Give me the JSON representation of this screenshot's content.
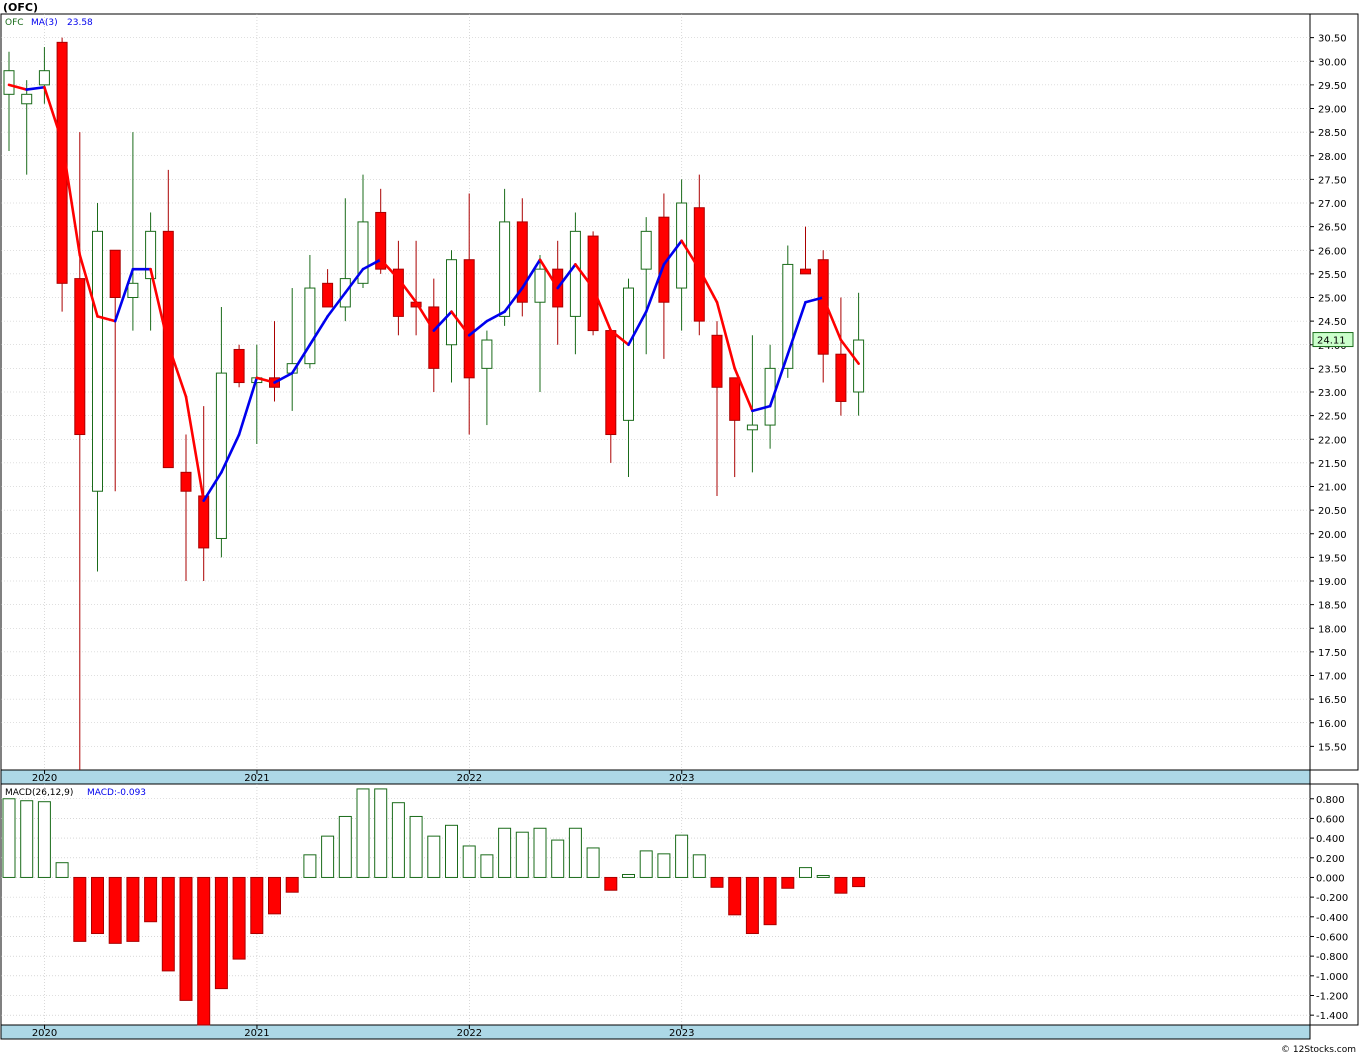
{
  "header": {
    "title": "(OFC)"
  },
  "legend": {
    "symbol": "OFC",
    "ma_label": "MA(3)",
    "ma_value": "23.58",
    "macd_label": "MACD(26,12,9)",
    "macd_value_label": "MACD:-0.093"
  },
  "last_price_label": "24.11",
  "watermark": "© 12Stocks.com",
  "colors": {
    "up": "#1a6b1a",
    "down": "#ff0000",
    "ma_up": "#0000ee",
    "ma_down": "#ff0000",
    "axis_band": "#add8e6",
    "grid": "#c0c0c0",
    "price_tag": "#ccffcc"
  },
  "chart_data": [
    {
      "type": "candlestick",
      "name": "price",
      "x_labels": [
        "2020",
        "2021",
        "2022",
        "2023"
      ],
      "x_label_index": [
        2,
        14,
        26,
        38
      ],
      "ylim": [
        15.0,
        31.0
      ],
      "yticks": [
        "15.50",
        "16.00",
        "16.50",
        "17.00",
        "17.50",
        "18.00",
        "18.50",
        "19.00",
        "19.50",
        "20.00",
        "20.50",
        "21.00",
        "21.50",
        "22.00",
        "22.50",
        "23.00",
        "23.50",
        "24.00",
        "24.50",
        "25.00",
        "25.50",
        "26.00",
        "26.50",
        "27.00",
        "27.50",
        "28.00",
        "28.50",
        "29.00",
        "29.50",
        "30.00",
        "30.50"
      ],
      "candles": [
        {
          "o": 29.3,
          "h": 30.2,
          "l": 28.1,
          "c": 29.8
        },
        {
          "o": 29.1,
          "h": 29.6,
          "l": 27.6,
          "c": 29.3
        },
        {
          "o": 29.5,
          "h": 30.3,
          "l": 29.1,
          "c": 29.8
        },
        {
          "o": 30.4,
          "h": 30.5,
          "l": 24.7,
          "c": 25.3
        },
        {
          "o": 25.4,
          "h": 28.5,
          "l": 15.0,
          "c": 22.1
        },
        {
          "o": 20.9,
          "h": 27.0,
          "l": 19.2,
          "c": 26.4
        },
        {
          "o": 26.0,
          "h": 26.0,
          "l": 20.9,
          "c": 25.0
        },
        {
          "o": 25.0,
          "h": 28.5,
          "l": 24.3,
          "c": 25.3
        },
        {
          "o": 25.4,
          "h": 26.8,
          "l": 24.3,
          "c": 26.4
        },
        {
          "o": 26.4,
          "h": 27.7,
          "l": 21.4,
          "c": 21.4
        },
        {
          "o": 21.3,
          "h": 22.1,
          "l": 19.0,
          "c": 20.9
        },
        {
          "o": 20.8,
          "h": 22.7,
          "l": 19.0,
          "c": 19.7
        },
        {
          "o": 19.9,
          "h": 24.8,
          "l": 19.5,
          "c": 23.4
        },
        {
          "o": 23.9,
          "h": 24.0,
          "l": 23.1,
          "c": 23.2
        },
        {
          "o": 23.2,
          "h": 24.0,
          "l": 21.9,
          "c": 23.3
        },
        {
          "o": 23.3,
          "h": 24.5,
          "l": 22.8,
          "c": 23.1
        },
        {
          "o": 23.4,
          "h": 25.2,
          "l": 22.6,
          "c": 23.6
        },
        {
          "o": 23.6,
          "h": 25.9,
          "l": 23.5,
          "c": 25.2
        },
        {
          "o": 25.3,
          "h": 25.6,
          "l": 24.8,
          "c": 24.8
        },
        {
          "o": 24.8,
          "h": 27.1,
          "l": 24.5,
          "c": 25.4
        },
        {
          "o": 25.3,
          "h": 27.6,
          "l": 25.2,
          "c": 26.6
        },
        {
          "o": 26.8,
          "h": 27.3,
          "l": 25.5,
          "c": 25.6
        },
        {
          "o": 25.6,
          "h": 26.2,
          "l": 24.2,
          "c": 24.6
        },
        {
          "o": 24.9,
          "h": 26.2,
          "l": 24.2,
          "c": 24.8
        },
        {
          "o": 24.8,
          "h": 25.4,
          "l": 23.0,
          "c": 23.5
        },
        {
          "o": 24.0,
          "h": 26.0,
          "l": 23.2,
          "c": 25.8
        },
        {
          "o": 25.8,
          "h": 27.2,
          "l": 22.1,
          "c": 23.3
        },
        {
          "o": 23.5,
          "h": 24.3,
          "l": 22.3,
          "c": 24.1
        },
        {
          "o": 24.6,
          "h": 27.3,
          "l": 24.4,
          "c": 26.6
        },
        {
          "o": 26.6,
          "h": 27.1,
          "l": 24.6,
          "c": 24.9
        },
        {
          "o": 24.9,
          "h": 25.9,
          "l": 23.0,
          "c": 25.6
        },
        {
          "o": 25.6,
          "h": 26.2,
          "l": 24.0,
          "c": 24.8
        },
        {
          "o": 24.6,
          "h": 26.8,
          "l": 23.8,
          "c": 26.4
        },
        {
          "o": 26.3,
          "h": 26.4,
          "l": 24.2,
          "c": 24.3
        },
        {
          "o": 24.3,
          "h": 24.3,
          "l": 21.5,
          "c": 22.1
        },
        {
          "o": 22.4,
          "h": 25.4,
          "l": 21.2,
          "c": 25.2
        },
        {
          "o": 25.6,
          "h": 26.7,
          "l": 23.8,
          "c": 26.4
        },
        {
          "o": 26.7,
          "h": 27.2,
          "l": 23.7,
          "c": 24.9
        },
        {
          "o": 25.2,
          "h": 27.5,
          "l": 24.3,
          "c": 27.0
        },
        {
          "o": 26.9,
          "h": 27.6,
          "l": 24.2,
          "c": 24.5
        },
        {
          "o": 24.2,
          "h": 24.5,
          "l": 20.8,
          "c": 23.1
        },
        {
          "o": 23.3,
          "h": 23.3,
          "l": 21.2,
          "c": 22.4
        },
        {
          "o": 22.2,
          "h": 24.2,
          "l": 21.3,
          "c": 22.3
        },
        {
          "o": 22.3,
          "h": 24.0,
          "l": 21.8,
          "c": 23.5
        },
        {
          "o": 23.5,
          "h": 26.1,
          "l": 23.3,
          "c": 25.7
        },
        {
          "o": 25.6,
          "h": 26.5,
          "l": 25.5,
          "c": 25.5
        },
        {
          "o": 25.8,
          "h": 26.0,
          "l": 23.2,
          "c": 23.8
        },
        {
          "o": 23.8,
          "h": 25.0,
          "l": 22.5,
          "c": 22.8
        },
        {
          "o": 23.0,
          "h": 25.1,
          "l": 22.5,
          "c": 24.1
        }
      ]
    },
    {
      "type": "line",
      "name": "MA(3)",
      "values": [
        29.5,
        29.4,
        29.45,
        28.3,
        25.9,
        24.6,
        24.5,
        25.6,
        25.6,
        24.0,
        22.9,
        20.7,
        21.3,
        22.1,
        23.3,
        23.2,
        23.4,
        24.0,
        24.6,
        25.1,
        25.6,
        25.8,
        25.4,
        24.9,
        24.3,
        24.7,
        24.2,
        24.5,
        24.7,
        25.2,
        25.8,
        25.2,
        25.7,
        25.2,
        24.3,
        24.0,
        24.7,
        25.7,
        26.2,
        25.6,
        24.9,
        23.5,
        22.6,
        22.7,
        23.8,
        24.9,
        25.0,
        24.1,
        23.6
      ]
    },
    {
      "type": "bar",
      "name": "MACD",
      "ylim": [
        -1.5,
        0.95
      ],
      "yticks": [
        "0.800",
        "0.600",
        "0.400",
        "0.200",
        "0.000",
        "-0.200",
        "-0.400",
        "-0.600",
        "-0.800",
        "-1.000",
        "-1.200",
        "-1.400"
      ],
      "values": [
        0.8,
        0.78,
        0.77,
        0.15,
        -0.65,
        -0.57,
        -0.67,
        -0.65,
        -0.45,
        -0.95,
        -1.25,
        -1.55,
        -1.13,
        -0.83,
        -0.57,
        -0.37,
        -0.15,
        0.23,
        0.42,
        0.62,
        0.9,
        0.9,
        0.76,
        0.62,
        0.42,
        0.53,
        0.32,
        0.23,
        0.5,
        0.46,
        0.5,
        0.38,
        0.5,
        0.3,
        -0.13,
        0.03,
        0.27,
        0.24,
        0.43,
        0.23,
        -0.1,
        -0.38,
        -0.57,
        -0.48,
        -0.11,
        0.1,
        0.02,
        -0.16,
        -0.093
      ]
    }
  ]
}
